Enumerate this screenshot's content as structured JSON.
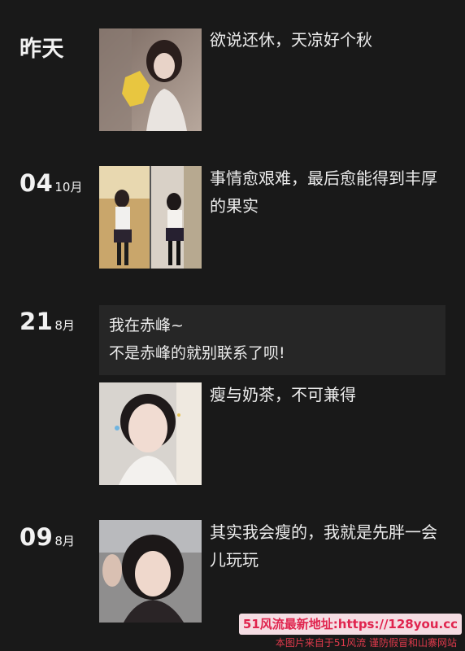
{
  "entries": [
    {
      "day": "昨天",
      "month": "",
      "caption": "欲说还休，天凉好个秋"
    },
    {
      "day": "04",
      "month": "10月",
      "caption": "事情愈艰难，最后愈能得到丰厚的果实"
    },
    {
      "day": "21",
      "month": "8月",
      "text_lines": [
        "我在赤峰~",
        "不是赤峰的就别联系了呗!"
      ],
      "caption": "瘦与奶茶，不可兼得"
    },
    {
      "day": "09",
      "month": "8月",
      "caption": "其实我会瘦的，我就是先胖一会儿玩玩"
    }
  ],
  "watermark": {
    "banner": "51风流最新地址:https://128you.cc",
    "footer": "本图片来自于51风流 谨防假冒和山寨网站"
  }
}
